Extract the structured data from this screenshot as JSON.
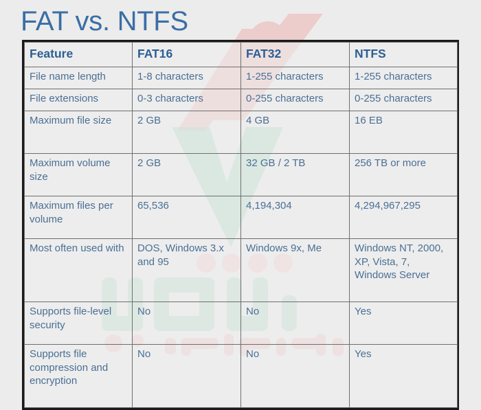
{
  "page": {
    "title": "FAT vs. NTFS",
    "background_color": "#ececec",
    "title_color": "#3a6ea5",
    "header_text_color": "#2c5f93",
    "body_text_color": "#4a6f94",
    "table_border_color": "#1a1a1a",
    "grid_line_color": "#6e6e6e"
  },
  "watermark": {
    "arabic_brand": "أهل",
    "arabic_tagline": "مقالات وشروحات",
    "pink_color": "#f0bdbd",
    "green_color": "#b7ddcd"
  },
  "table": {
    "columns": [
      "Feature",
      "FAT16",
      "FAT32",
      "NTFS"
    ],
    "rows": [
      {
        "feature": "File name length",
        "fat16": "1-8 characters",
        "fat32": "1-255 characters",
        "ntfs": "1-255 characters",
        "height": "r-h30"
      },
      {
        "feature": "File extensions",
        "fat16": "0-3 characters",
        "fat32": "0-255 characters",
        "ntfs": "0-255 characters",
        "height": "r-h30"
      },
      {
        "feature": "Maximum file size",
        "fat16": "2 GB",
        "fat32": "4 GB",
        "ntfs": "16 EB",
        "height": "r-h60"
      },
      {
        "feature": "Maximum volume size",
        "fat16": "2 GB",
        "fat32": "32 GB / 2 TB",
        "ntfs": "256 TB or more",
        "height": "r-h60"
      },
      {
        "feature": "Maximum files per volume",
        "fat16": "65,536",
        "fat32": "4,194,304",
        "ntfs": "4,294,967,295",
        "height": "r-h60"
      },
      {
        "feature": "Most often used with",
        "fat16": "DOS, Windows 3.x and 95",
        "fat32": "Windows 9x, Me",
        "ntfs": "Windows NT, 2000, XP, Vista, 7, Windows Server",
        "height": "r-h90"
      },
      {
        "feature": "Supports file-level security",
        "fat16": "No",
        "fat32": "No",
        "ntfs": "Yes",
        "height": "r-h60"
      },
      {
        "feature": "Supports file compression and encryption",
        "fat16": "No",
        "fat32": "No",
        "ntfs": "Yes",
        "height": "r-h90"
      }
    ]
  }
}
